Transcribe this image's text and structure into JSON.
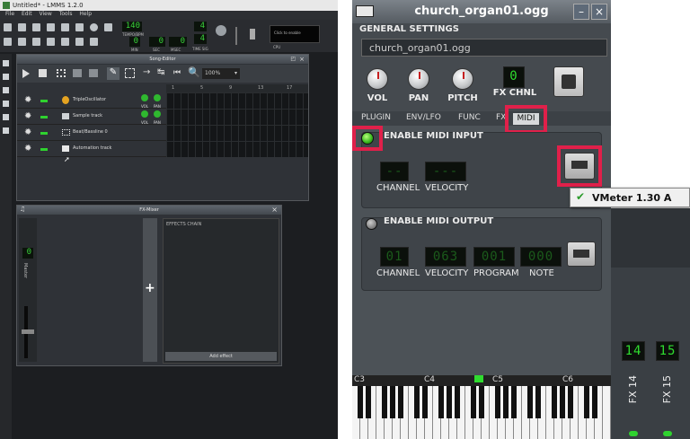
{
  "lmms": {
    "window_title": "Untitled* - LMMS 1.2.0",
    "menus": [
      "File",
      "Edit",
      "View",
      "Tools",
      "Help"
    ],
    "tempo": "140",
    "tempo_label": "TEMPO/BPM",
    "time_min": "0",
    "time_sec": "0",
    "time_msec": "0",
    "min_label": "MIN",
    "sec_label": "SEC",
    "msec_label": "MSEC",
    "sig_num": "4",
    "sig_den": "4",
    "sig_label": "TIME SIG",
    "cpu_hint": "Click to enable",
    "cpu_label": "CPU"
  },
  "song_editor": {
    "title": "Song-Editor",
    "zoom": "100%",
    "ruler": [
      "1",
      "5",
      "9",
      "13",
      "17"
    ],
    "vol_label": "VOL",
    "pan_label": "PAN",
    "tracks": [
      {
        "name": "TripleOscillator",
        "has_knobs": true
      },
      {
        "name": "Sample track",
        "has_knobs": true
      },
      {
        "name": "Beat/Bassline 0",
        "has_knobs": false
      },
      {
        "name": "Automation track",
        "has_knobs": false
      }
    ]
  },
  "fx_mixer": {
    "title": "FX-Mixer",
    "master_value": "0",
    "master_label": "Master",
    "effects_chain": "EFFECTS CHAIN",
    "add_effect": "Add effect"
  },
  "instrument": {
    "title": "church_organ01.ogg",
    "general_settings": "GENERAL SETTINGS",
    "name_value": "church_organ01.ogg",
    "knobs": [
      "VOL",
      "PAN",
      "PITCH"
    ],
    "fx_chnl_label": "FX CHNL",
    "fx_chnl_value": "0",
    "tabs": [
      "PLUGIN",
      "ENV/LFO",
      "FUNC",
      "FX",
      "MIDI"
    ],
    "active_tab": "MIDI",
    "enable_midi_input": "ENABLE MIDI INPUT",
    "in_channel_label": "CHANNEL",
    "in_velocity_label": "VELOCITY",
    "in_channel_value": "--",
    "in_velocity_value": "---",
    "dropdown_item": "VMeter 1.30 A",
    "enable_midi_output": "ENABLE MIDI OUTPUT",
    "out_labels": [
      "CHANNEL",
      "VELOCITY",
      "PROGRAM",
      "NOTE"
    ],
    "out_values": [
      "01",
      "063",
      "001",
      "000"
    ],
    "piano_keys": [
      "C3",
      "C4",
      "C5",
      "C6"
    ]
  },
  "mixer_side": {
    "ch1": "14",
    "ch2": "15",
    "fx1": "FX 14",
    "fx2": "FX 15"
  },
  "colors": {
    "highlight": "#e0204a",
    "lcd_green": "#2fdc2f"
  }
}
